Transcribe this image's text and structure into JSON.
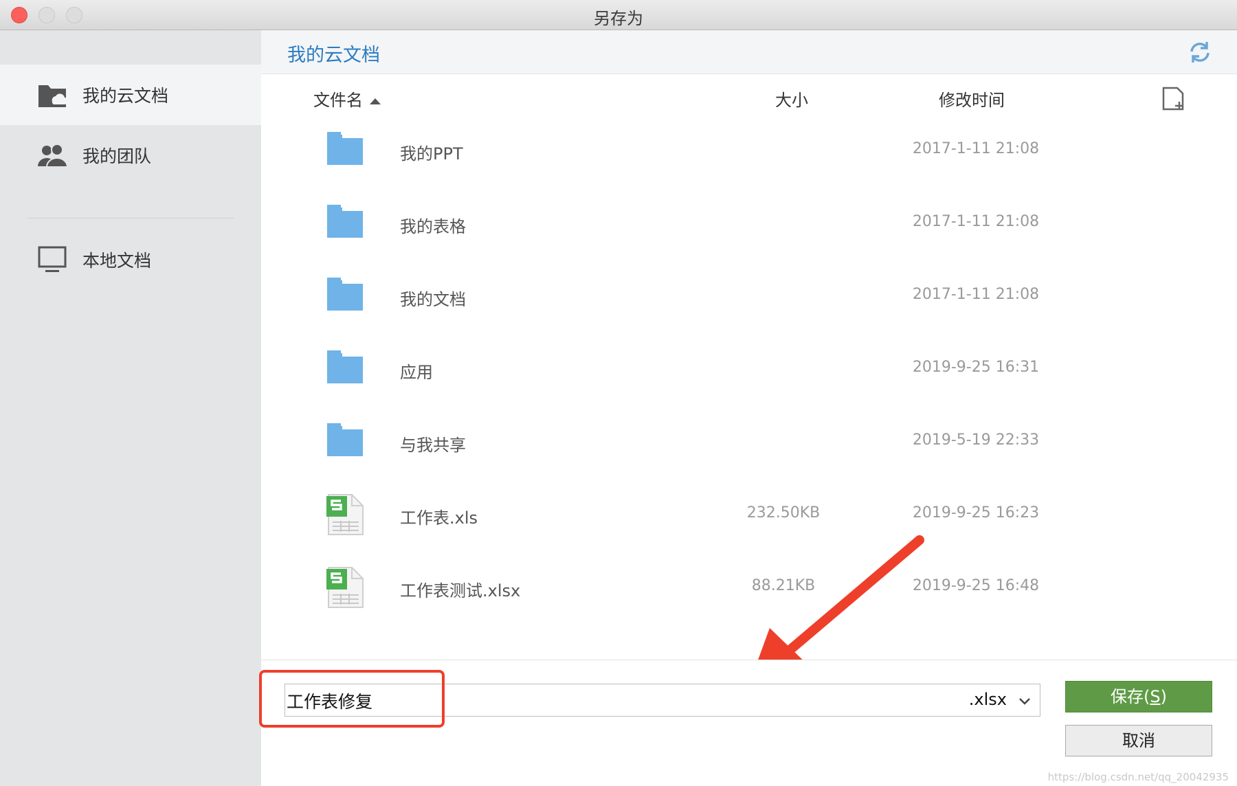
{
  "window": {
    "title": "另存为"
  },
  "sidebar": {
    "items": [
      {
        "label": "我的云文档",
        "icon": "cloud-folder-icon",
        "active": true
      },
      {
        "label": "我的团队",
        "icon": "team-icon",
        "active": false
      },
      {
        "label": "本地文档",
        "icon": "monitor-icon",
        "active": false
      }
    ]
  },
  "main": {
    "breadcrumb": "我的云文档",
    "columns": {
      "name": "文件名",
      "size": "大小",
      "time": "修改时间"
    },
    "rows": [
      {
        "name": "我的PPT",
        "size": "",
        "time": "2017-1-11 21:08",
        "type": "folder"
      },
      {
        "name": "我的表格",
        "size": "",
        "time": "2017-1-11 21:08",
        "type": "folder"
      },
      {
        "name": "我的文档",
        "size": "",
        "time": "2017-1-11 21:08",
        "type": "folder"
      },
      {
        "name": "应用",
        "size": "",
        "time": "2019-9-25 16:31",
        "type": "folder"
      },
      {
        "name": "与我共享",
        "size": "",
        "time": "2019-5-19 22:33",
        "type": "folder"
      },
      {
        "name": "工作表.xls",
        "size": "232.50KB",
        "time": "2019-9-25 16:23",
        "type": "sheet"
      },
      {
        "name": "工作表测试.xlsx",
        "size": "88.21KB",
        "time": "2019-9-25 16:48",
        "type": "sheet"
      }
    ]
  },
  "bottom": {
    "filename": "工作表修复",
    "extension": ".xlsx",
    "save_label": "保存(",
    "save_key": "S",
    "save_tail": ")",
    "cancel_label": "取消",
    "watermark": "https://blog.csdn.net/qq_20042935"
  },
  "colors": {
    "accent": "#2b7cc4",
    "save": "#5f9b46",
    "folder": "#6fb3e8",
    "sheet": "#4caf50",
    "annotation": "#ee3f2b"
  }
}
